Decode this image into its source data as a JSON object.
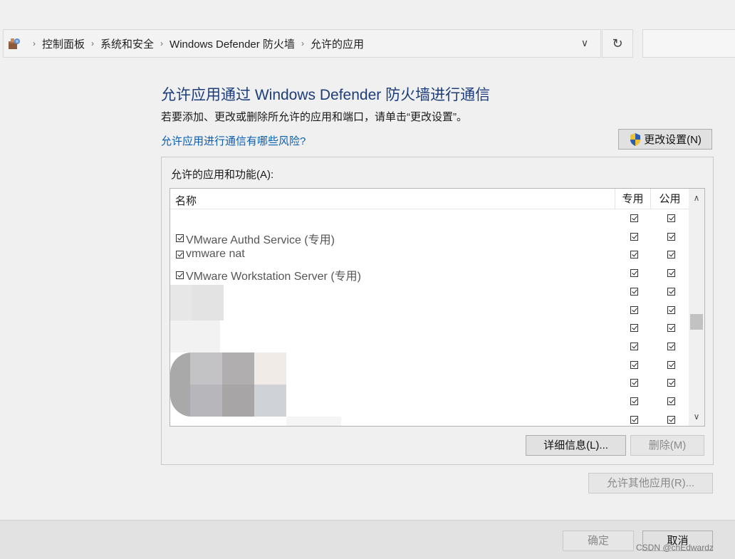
{
  "breadcrumb": {
    "items": [
      "控制面板",
      "系统和安全",
      "Windows Defender 防火墙",
      "允许的应用"
    ]
  },
  "header": {
    "title": "允许应用通过 Windows Defender 防火墙进行通信",
    "subtitle": "若要添加、更改或删除所允许的应用和端口，请单击“更改设置”。",
    "risk_link": "允许应用进行通信有哪些风险?",
    "change_settings": "更改设置(N)"
  },
  "group": {
    "label": "允许的应用和功能(A):",
    "columns": {
      "name": "名称",
      "private": "专用",
      "public": "公用"
    },
    "rows": [
      {
        "name": "",
        "private": true,
        "public": true
      },
      {
        "name": "VMware Authd Service (专用)",
        "private": true,
        "public": true
      },
      {
        "name": "vmware nat",
        "private": true,
        "public": true
      },
      {
        "name": "VMware Workstation Server (专用)",
        "private": true,
        "public": true
      },
      {
        "name": "",
        "private": true,
        "public": true
      },
      {
        "name": "",
        "private": true,
        "public": true
      },
      {
        "name": "",
        "private": true,
        "public": true
      },
      {
        "name": "",
        "private": true,
        "public": true
      },
      {
        "name": "",
        "private": true,
        "public": true
      },
      {
        "name": "",
        "private": true,
        "public": true
      },
      {
        "name": "",
        "private": true,
        "public": true
      },
      {
        "name": "",
        "private": true,
        "public": true
      }
    ],
    "details_button": "详细信息(L)...",
    "remove_button": "删除(M)"
  },
  "allow_other_button": "允许其他应用(R)...",
  "footer": {
    "ok": "确定",
    "cancel": "取消"
  },
  "watermark": "CSDN @chEdwardz"
}
